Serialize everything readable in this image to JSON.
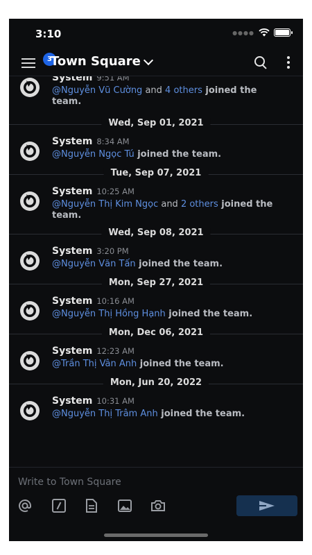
{
  "statusbar": {
    "time": "3:10"
  },
  "header": {
    "badge_count": "3",
    "channel_title": "Town Square"
  },
  "first_post": {
    "sender": "System",
    "time": "9:51 AM",
    "mention": "@Nguyễn Vũ Cường",
    "and": " and ",
    "others": "4 others",
    "rest": " joined the team."
  },
  "groups": [
    {
      "date": "Wed, Sep 01, 2021",
      "sender": "System",
      "time": "8:34 AM",
      "mention": "@Nguyễn Ngọc Tú",
      "rest": " joined the team."
    },
    {
      "date": "Tue, Sep 07, 2021",
      "sender": "System",
      "time": "10:25 AM",
      "mention": "@Nguyễn Thị Kim Ngọc",
      "and": " and ",
      "others": "2 others",
      "rest": " joined the team."
    },
    {
      "date": "Wed, Sep 08, 2021",
      "sender": "System",
      "time": "3:20 PM",
      "mention": "@Nguyễn Văn Tấn",
      "rest": " joined the team."
    },
    {
      "date": "Mon, Sep 27, 2021",
      "sender": "System",
      "time": "10:16 AM",
      "mention": "@Nguyễn Thị Hồng Hạnh",
      "rest": " joined the team."
    },
    {
      "date": "Mon, Dec 06, 2021",
      "sender": "System",
      "time": "12:23 AM",
      "mention": "@Trần Thị Vân Anh",
      "rest": " joined the team."
    },
    {
      "date": "Mon, Jun 20, 2022",
      "sender": "System",
      "time": "10:31 AM",
      "mention": "@Nguyễn Thị Trâm Anh",
      "rest": " joined the team."
    }
  ],
  "composer": {
    "placeholder": "Write to Town Square",
    "tools": [
      "at-mention-icon",
      "slash-command-icon",
      "file-icon",
      "image-icon",
      "camera-icon"
    ]
  },
  "colors": {
    "background": "#0c0d0f",
    "mention": "#5e8fe0",
    "badge": "#1e64e6",
    "send_button": "#15304f"
  }
}
